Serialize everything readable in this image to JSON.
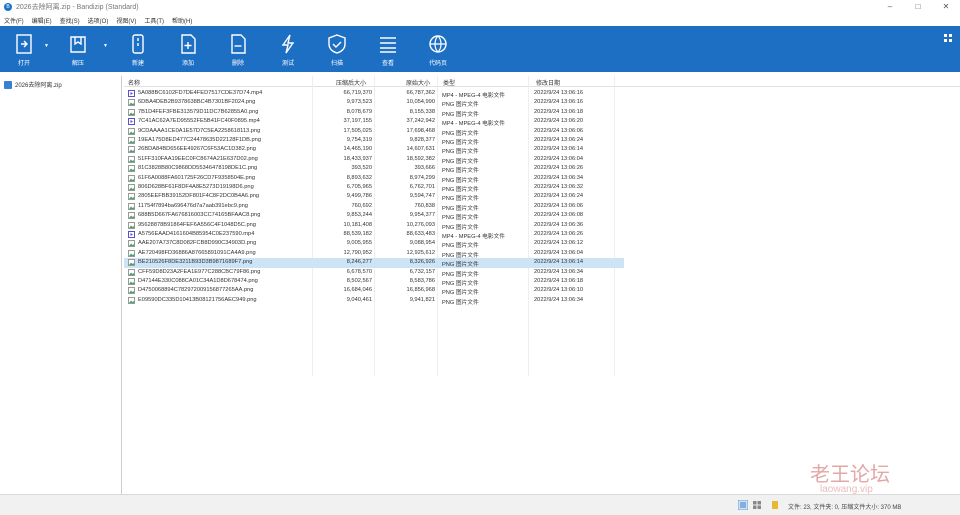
{
  "window": {
    "title": "2026去除阿离.zip - Bandizip (Standard)"
  },
  "menu": [
    "文件(F)",
    "编辑(E)",
    "查找(S)",
    "选项(O)",
    "视图(V)",
    "工具(T)",
    "帮助(H)"
  ],
  "toolbar": [
    {
      "label": "打开",
      "icon": "open-icon"
    },
    {
      "label": "解压",
      "icon": "extract-icon"
    },
    {
      "label": "新建",
      "icon": "new-archive-icon"
    },
    {
      "label": "添加",
      "icon": "add-icon"
    },
    {
      "label": "删除",
      "icon": "delete-icon"
    },
    {
      "label": "测试",
      "icon": "test-icon"
    },
    {
      "label": "扫描",
      "icon": "scan-icon"
    },
    {
      "label": "查看",
      "icon": "view-icon"
    },
    {
      "label": "代码页",
      "icon": "codepage-icon"
    }
  ],
  "tree": {
    "root": "2026去除阿离.zip"
  },
  "columns": {
    "name": "名称",
    "packed": "压缩后大小",
    "size": "原始大小",
    "type": "类型",
    "modified": "修改日期"
  },
  "files": [
    {
      "name": "5A088BC6102FD7DE4FED7517CDE37D74.mp4",
      "packed": "66,719,370",
      "size": "66,787,362",
      "type": "MP4 - MPEG-4 电影文件",
      "modified": "2022/9/24 13:06:16",
      "kind": "mp4"
    },
    {
      "name": "6DBA4DEB2B9378638BC4B7301BF2024.png",
      "packed": "9,973,523",
      "size": "10,054,990",
      "type": "PNG 图片文件",
      "modified": "2022/9/24 13:06:16",
      "kind": "png"
    },
    {
      "name": "7B1D4FEF3FBE313579D11DC7B62855A0.png",
      "packed": "8,078,679",
      "size": "8,155,338",
      "type": "PNG 图片文件",
      "modified": "2022/9/24 13:06:18",
      "kind": "png"
    },
    {
      "name": "7C41AC62A7ED95552FE5B41FC40F0895.mp4",
      "packed": "37,197,155",
      "size": "37,242,942",
      "type": "MP4 - MPEG-4 电影文件",
      "modified": "2022/9/24 13:06:20",
      "kind": "mp4"
    },
    {
      "name": "9CDAAAA1CE0A1E57D7C5EA2258618113.png",
      "packed": "17,505,025",
      "size": "17,698,468",
      "type": "PNG 图片文件",
      "modified": "2022/9/24 13:06:06",
      "kind": "png"
    },
    {
      "name": "19EA175D8ED477C24478635D22128F1DB.png",
      "packed": "9,754,319",
      "size": "9,828,377",
      "type": "PNG 图片文件",
      "modified": "2022/9/24 13:06:24",
      "kind": "png"
    },
    {
      "name": "26BDA84BD656EE49267C6F53AC1D382.png",
      "packed": "14,465,190",
      "size": "14,607,631",
      "type": "PNG 图片文件",
      "modified": "2022/9/24 13:06:14",
      "kind": "png"
    },
    {
      "name": "51FF310FAA19EEC0FC8674A21E637D02.png",
      "packed": "18,433,937",
      "size": "18,592,382",
      "type": "PNG 图片文件",
      "modified": "2022/9/24 13:06:04",
      "kind": "png"
    },
    {
      "name": "81C3828B80C9868DD55346478198DE1C.png",
      "packed": "393,520",
      "size": "393,666",
      "type": "PNG 图片文件",
      "modified": "2022/9/24 13:06:26",
      "kind": "png"
    },
    {
      "name": "61F6A0088FA601725F26CD7F9358504E.png",
      "packed": "8,893,632",
      "size": "8,974,299",
      "type": "PNG 图片文件",
      "modified": "2022/9/24 13:06:34",
      "kind": "png"
    },
    {
      "name": "806D628BF61F8DF4A8E5273D19198D6.png",
      "packed": "6,705,965",
      "size": "6,762,701",
      "type": "PNG 图片文件",
      "modified": "2022/9/24 13:06:32",
      "kind": "png"
    },
    {
      "name": "2805EEFBB39152DF801F4C8F2DC0B4A6.png",
      "packed": "9,499,786",
      "size": "9,594,747",
      "type": "PNG 图片文件",
      "modified": "2022/9/24 13:06:24",
      "kind": "png"
    },
    {
      "name": "11754f7894ba696476d7a7aab391ebc9.png",
      "packed": "760,692",
      "size": "760,838",
      "type": "PNG 图片文件",
      "modified": "2022/9/24 13:06:06",
      "kind": "png"
    },
    {
      "name": "688B5D667FA676816003CC74165BFAAC8.png",
      "packed": "9,853,244",
      "size": "9,954,377",
      "type": "PNG 图片文件",
      "modified": "2022/9/24 13:06:08",
      "kind": "png"
    },
    {
      "name": "95628878B91864FEF6A556C4F1048D5C.png",
      "packed": "10,181,408",
      "size": "10,276,093",
      "type": "PNG 图片文件",
      "modified": "2022/9/24 13:06:36",
      "kind": "png"
    },
    {
      "name": "A5756EAAD4161604B85954C0E237590.mp4",
      "packed": "88,539,182",
      "size": "88,633,483",
      "type": "MP4 - MPEG-4 电影文件",
      "modified": "2022/9/24 13:06:26",
      "kind": "mp4"
    },
    {
      "name": "AAE207A737C8D082FCB8D990C34903D.png",
      "packed": "9,005,955",
      "size": "9,088,954",
      "type": "PNG 图片文件",
      "modified": "2022/9/24 13:06:12",
      "kind": "png"
    },
    {
      "name": "AE720498FD36886A87665891091CA4A9.png",
      "packed": "12,790,952",
      "size": "12,925,612",
      "type": "PNG 图片文件",
      "modified": "2022/9/24 13:06:04",
      "kind": "png"
    },
    {
      "name": "BE210526F8DE3211B93D3B9871689F7.png",
      "packed": "8,246,277",
      "size": "8,326,926",
      "type": "PNG 图片文件",
      "modified": "2022/9/24 13:06:14",
      "kind": "png",
      "selected": true
    },
    {
      "name": "CFF59D8D23A2FEA1E977C288CBC79F86.png",
      "packed": "6,678,570",
      "size": "6,732,157",
      "type": "PNG 图片文件",
      "modified": "2022/9/24 13:06:34",
      "kind": "png"
    },
    {
      "name": "D47144E330C088CA01C34A1D8D678474.png",
      "packed": "8,502,567",
      "size": "8,583,786",
      "type": "PNG 图片文件",
      "modified": "2022/9/24 13:06:18",
      "kind": "png"
    },
    {
      "name": "D4750068894C782972009156877265AA.png",
      "packed": "16,684,046",
      "size": "16,856,968",
      "type": "PNG 图片文件",
      "modified": "2022/9/24 13:06:10",
      "kind": "png"
    },
    {
      "name": "E09590DC335D10413B08121756AEC949.png",
      "packed": "9,040,461",
      "size": "9,941,821",
      "type": "PNG 图片文件",
      "modified": "2022/9/24 13:06:34",
      "kind": "png"
    }
  ],
  "status": {
    "text": "文件: 23, 文件夹: 0, 压缩文件大小: 370 MB"
  },
  "watermark": {
    "main": "老王论坛",
    "sub": "laowang.vip"
  },
  "colors": {
    "toolbar": "#1d6fc4",
    "selected_row": "#cde4f7"
  }
}
